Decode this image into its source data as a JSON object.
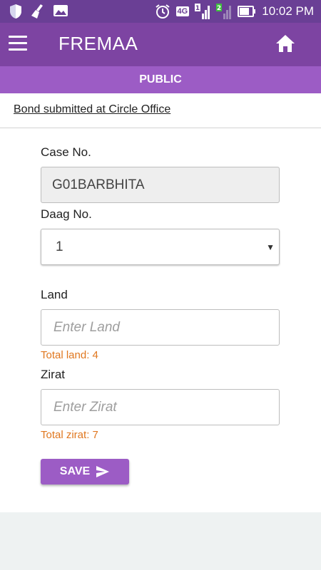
{
  "status_bar": {
    "network": "4G",
    "sim1": "1",
    "sim2": "2",
    "time": "10:02 PM"
  },
  "app_bar": {
    "title": "FREMAA"
  },
  "sub_header": {
    "label": "PUBLIC"
  },
  "form": {
    "bond_link": "Bond submitted at Circle Office",
    "case_no": {
      "label": "Case No.",
      "value": "G01BARBHITA"
    },
    "daag_no": {
      "label": "Daag No.",
      "selected": "1"
    },
    "land": {
      "label": "Land",
      "placeholder": "Enter Land",
      "value": "",
      "hint": "Total land: 4"
    },
    "zirat": {
      "label": "Zirat",
      "placeholder": "Enter Zirat",
      "value": "",
      "hint": "Total zirat: 7"
    },
    "save_label": "SAVE"
  },
  "colors": {
    "status_bar": "#6a3f95",
    "app_bar": "#7d44a2",
    "accent": "#9c5cc5",
    "hint": "#e0771f"
  }
}
